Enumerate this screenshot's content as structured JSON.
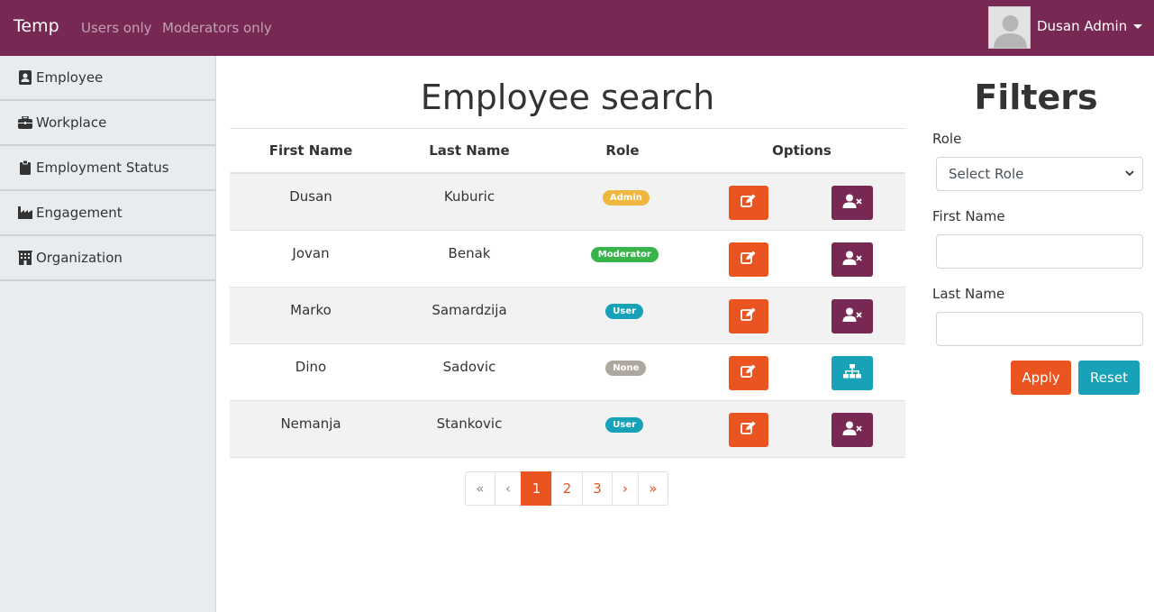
{
  "navbar": {
    "brand": "Temp",
    "links": [
      "Users only",
      "Moderators only"
    ],
    "user_name": "Dusan Admin",
    "background": "#772953"
  },
  "sidebar": {
    "items": [
      {
        "label": "Employee",
        "icon": "id-card-icon"
      },
      {
        "label": "Workplace",
        "icon": "briefcase-icon"
      },
      {
        "label": "Employment Status",
        "icon": "clipboard-icon"
      },
      {
        "label": "Engagement",
        "icon": "industry-icon"
      },
      {
        "label": "Organization",
        "icon": "building-icon"
      }
    ]
  },
  "main": {
    "title": "Employee search",
    "columns": [
      "First Name",
      "Last Name",
      "Role",
      "Options"
    ],
    "rows": [
      {
        "first": "Dusan",
        "last": "Kuburic",
        "role": "Admin",
        "role_color": "#efb73e",
        "action": "remove-user-icon",
        "action_color": "#772953"
      },
      {
        "first": "Jovan",
        "last": "Benak",
        "role": "Moderator",
        "role_color": "#38b44a",
        "action": "remove-user-icon",
        "action_color": "#772953"
      },
      {
        "first": "Marko",
        "last": "Samardzija",
        "role": "User",
        "role_color": "#17a2b8",
        "action": "remove-user-icon",
        "action_color": "#772953"
      },
      {
        "first": "Dino",
        "last": "Sadovic",
        "role": "None",
        "role_color": "#aea79f",
        "action": "sitemap-icon",
        "action_color": "#17a2b8"
      },
      {
        "first": "Nemanja",
        "last": "Stankovic",
        "role": "User",
        "role_color": "#17a2b8",
        "action": "remove-user-icon",
        "action_color": "#772953"
      }
    ],
    "edit_color": "#e95420"
  },
  "pagination": {
    "first": "«",
    "prev": "‹",
    "pages": [
      "1",
      "2",
      "3"
    ],
    "active_page": "1",
    "next": "›",
    "last": "»"
  },
  "filters": {
    "title": "Filters",
    "role_label": "Role",
    "role_selected": "Select Role",
    "first_name_label": "First Name",
    "first_name_value": "",
    "last_name_label": "Last Name",
    "last_name_value": "",
    "apply_label": "Apply",
    "reset_label": "Reset",
    "apply_color": "#e95420",
    "reset_color": "#17a2b8"
  }
}
